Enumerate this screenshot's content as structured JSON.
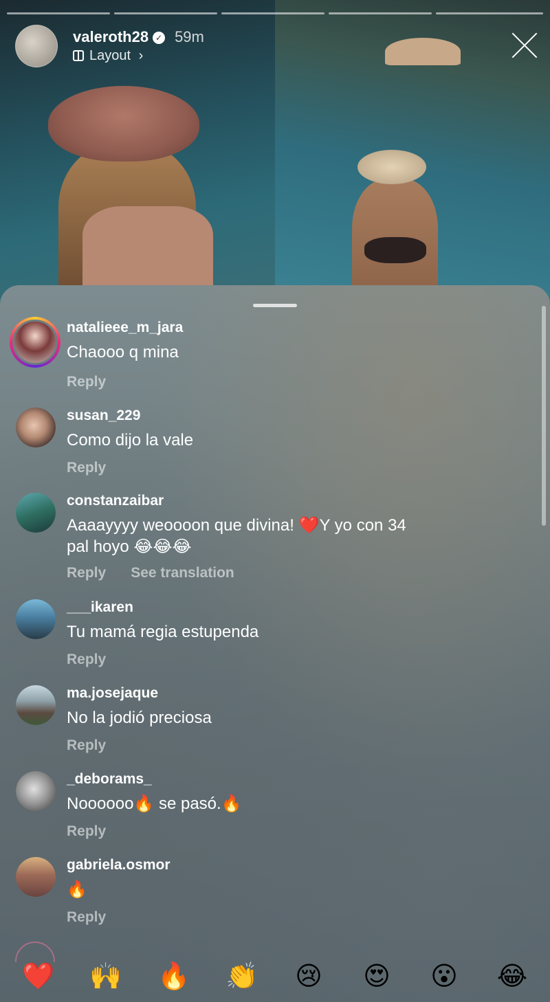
{
  "story": {
    "username": "valeroth28",
    "time": "59m",
    "layout_label": "Layout",
    "layout_chevron": "›"
  },
  "comments": [
    {
      "user": "natalieee_m_jara",
      "text": "Chaooo q mina",
      "reply": "Reply"
    },
    {
      "user": "susan_229",
      "text": "Como dijo la vale",
      "reply": "Reply"
    },
    {
      "user": "constanzaibar",
      "text": "Aaaayyyy weoooon que divina! ❤️Y yo con 34",
      "text2": "pal hoyo 😂😂😂",
      "reply": "Reply",
      "translate": "See translation"
    },
    {
      "user": "___ikaren",
      "text": "Tu mamá regia estupenda",
      "reply": "Reply"
    },
    {
      "user": "ma.josejaque",
      "text": "No la jodió preciosa",
      "reply": "Reply"
    },
    {
      "user": "_deborams_",
      "text": "Noooooo🔥 se pasó.🔥",
      "reply": "Reply"
    },
    {
      "user": "gabriela.osmor",
      "text": "🔥",
      "reply": "Reply"
    }
  ],
  "reactions": [
    "❤️",
    "🙌",
    "🔥",
    "👏",
    "😢",
    "😍",
    "😮",
    "😂"
  ],
  "colors": {
    "sheet": "#6c7a7e",
    "reply": "rgba(255,255,255,0.55)",
    "story_ring": "#ee2a7b"
  },
  "icons": {
    "verified": "verified-badge-icon",
    "close": "close-icon",
    "layout": "layout-icon"
  }
}
